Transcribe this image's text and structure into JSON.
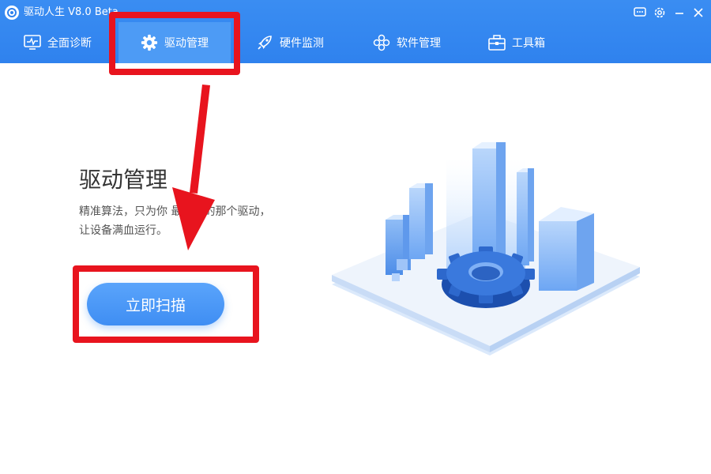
{
  "window": {
    "title": "驱动人生 V8.0 Beta"
  },
  "tabs": [
    {
      "label": "全面诊断",
      "icon": "monitor-icon"
    },
    {
      "label": "驱动管理",
      "icon": "gear-icon",
      "active": true
    },
    {
      "label": "硬件监测",
      "icon": "rocket-icon"
    },
    {
      "label": "软件管理",
      "icon": "apps-icon"
    },
    {
      "label": "工具箱",
      "icon": "toolbox-icon"
    }
  ],
  "main": {
    "heading": "驱动管理",
    "desc_line1": "精准算法，只为你  最合适的那个驱动，",
    "desc_line2": "让设备满血运行。",
    "scan_button": "立即扫描"
  },
  "colors": {
    "header": "#2f82ee",
    "active_tab": "#4d9bf5",
    "highlight": "#e8141e",
    "button": "#4a97f6"
  }
}
